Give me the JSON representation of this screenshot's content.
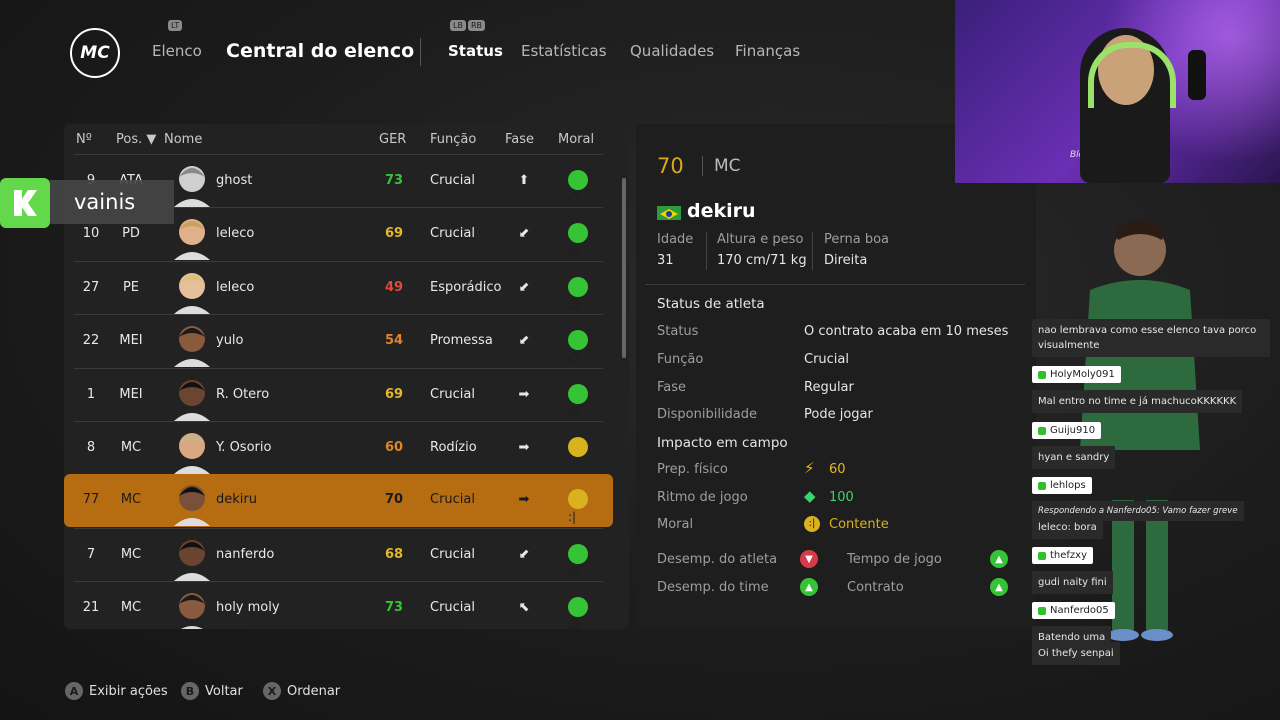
{
  "nav": {
    "logo": "MC",
    "bumper_left": "LT",
    "bumper_right_1": "LB",
    "bumper_right_2": "RB",
    "elenco": "Elenco",
    "title": "Central do elenco",
    "tabs": [
      "Status",
      "Estatísticas",
      "Qualidades",
      "Finanças"
    ]
  },
  "table": {
    "headers": {
      "num": "Nº",
      "pos": "Pos. ▼",
      "name": "Nome",
      "ger": "GER",
      "func": "Função",
      "fase": "Fase",
      "moral": "Moral"
    },
    "rows": [
      {
        "num": "9",
        "pos": "ATA",
        "name": "ghost",
        "ger": "73",
        "func": "Crucial",
        "fase": "⬆",
        "ger_color": "#35c435",
        "moral": "green"
      },
      {
        "num": "10",
        "pos": "PD",
        "name": "leleco",
        "ger": "69",
        "func": "Crucial",
        "fase": "⬋",
        "ger_color": "#e3b928",
        "moral": "green"
      },
      {
        "num": "27",
        "pos": "PE",
        "name": "leleco",
        "ger": "49",
        "func": "Esporádico",
        "fase": "⬋",
        "ger_color": "#e04a3a",
        "moral": "green"
      },
      {
        "num": "22",
        "pos": "MEI",
        "name": "yulo",
        "ger": "54",
        "func": "Promessa",
        "fase": "⬋",
        "ger_color": "#e0832a",
        "moral": "green"
      },
      {
        "num": "1",
        "pos": "MEI",
        "name": "R. Otero",
        "ger": "69",
        "func": "Crucial",
        "fase": "➡",
        "ger_color": "#e3b928",
        "moral": "green"
      },
      {
        "num": "8",
        "pos": "MC",
        "name": "Y. Osorio",
        "ger": "60",
        "func": "Rodízio",
        "fase": "➡",
        "ger_color": "#e0832a",
        "moral": "yellow"
      },
      {
        "num": "77",
        "pos": "MC",
        "name": "dekiru",
        "ger": "70",
        "func": "Crucial",
        "fase": "➡",
        "ger_color": "#1a1a1a",
        "moral": "yellow"
      },
      {
        "num": "7",
        "pos": "MC",
        "name": "nanferdo",
        "ger": "68",
        "func": "Crucial",
        "fase": "⬋",
        "ger_color": "#e3b928",
        "moral": "green"
      },
      {
        "num": "21",
        "pos": "MC",
        "name": "holy moly",
        "ger": "73",
        "func": "Crucial",
        "fase": "⬉",
        "ger_color": "#35c435",
        "moral": "green"
      }
    ]
  },
  "overlay": {
    "vainis": "vainis"
  },
  "detail": {
    "ger": "70",
    "pos": "MC",
    "name": "dekiru",
    "idade_label": "Idade",
    "idade": "31",
    "altura_label": "Altura e peso",
    "altura": "170 cm/71 kg",
    "perna_label": "Perna boa",
    "perna": "Direita",
    "status_heading": "Status de atleta",
    "status_label": "Status",
    "status": "O contrato acaba em 10 meses",
    "funcao_label": "Função",
    "funcao": "Crucial",
    "fase_label": "Fase",
    "fase": "Regular",
    "disp_label": "Disponibilidade",
    "disp": "Pode jogar",
    "impacto_heading": "Impacto em campo",
    "prep_label": "Prep. físico",
    "prep": "60",
    "ritmo_label": "Ritmo de jogo",
    "ritmo": "100",
    "moral_label": "Moral",
    "moral": "Contente",
    "desemp_atleta": "Desemp. do atleta",
    "desemp_time": "Desemp. do time",
    "tempo_jogo": "Tempo de jogo",
    "contrato": "Contrato"
  },
  "chat": {
    "m0": "nao lembrava como esse elenco tava porco visualmente",
    "u1": "HolyMoly091",
    "m1": "Mal entro no time e já machucoKKKKKK",
    "u2": "Guiju910",
    "m2": "hyan e sandry",
    "u3": "lehlops",
    "m3a": "Respondendo a Nanferdo05: Vamo fazer greve",
    "m3b": "leleco: bora",
    "u4": "thefzxy",
    "m4": "gudi naity fini",
    "u5": "Nanferdo05",
    "m5": "Batendo uma",
    "m5b": "Oi thefy senpai"
  },
  "webcam": {
    "shirt_text": "Bloodborne"
  },
  "hints": [
    {
      "key": "A",
      "label": "Exibir ações"
    },
    {
      "key": "B",
      "label": "Voltar"
    },
    {
      "key": "X",
      "label": "Ordenar"
    }
  ],
  "colors": {
    "accent": "#b66d12",
    "good": "#35c435",
    "gold": "#d8b21f"
  }
}
